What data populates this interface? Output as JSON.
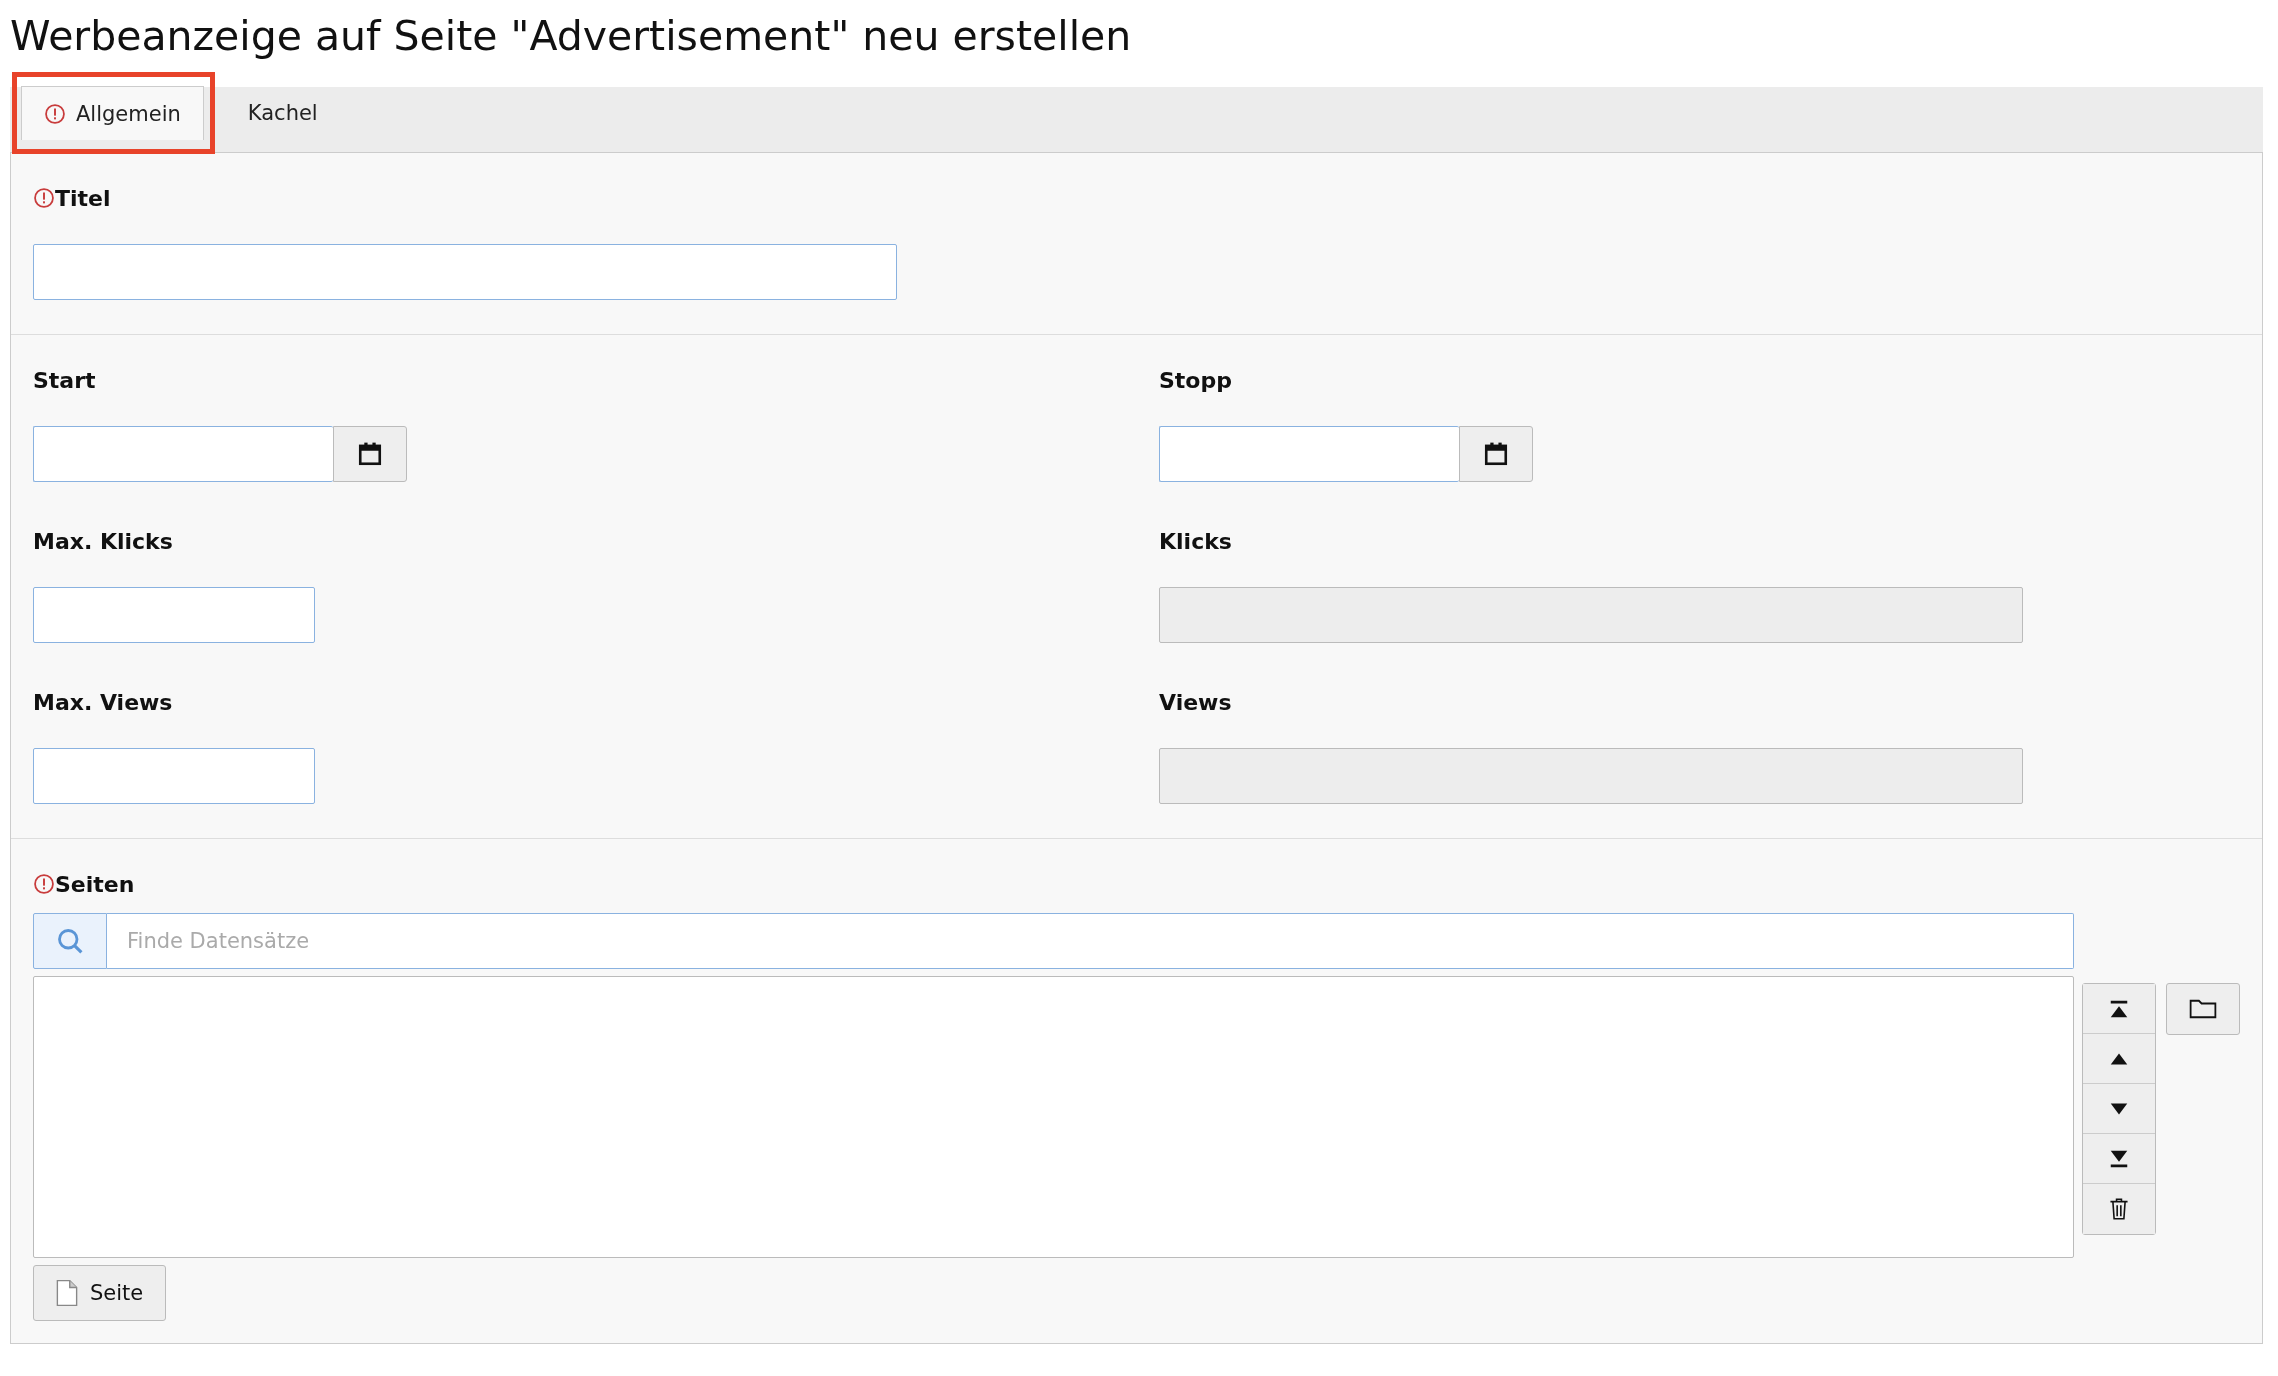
{
  "page_title": "Werbeanzeige auf Seite \"Advertisement\" neu erstellen",
  "tabs": [
    {
      "label": "Allgemein",
      "selected": true,
      "error": true,
      "highlighted": true
    },
    {
      "label": "Kachel",
      "selected": false,
      "error": false,
      "highlighted": false
    }
  ],
  "titel": {
    "label": "Titel",
    "error": true
  },
  "rows": [
    [
      {
        "kind": "date",
        "label": "Start"
      },
      {
        "kind": "date",
        "label": "Stopp"
      }
    ],
    [
      {
        "kind": "number",
        "label": "Max. Klicks"
      },
      {
        "kind": "readonly",
        "label": "Klicks"
      }
    ],
    [
      {
        "kind": "number",
        "label": "Max. Views"
      },
      {
        "kind": "readonly",
        "label": "Views"
      }
    ]
  ],
  "seiten": {
    "label": "Seiten",
    "error": true,
    "search": {
      "placeholder": "Finde Datensätze"
    },
    "add_button": "Seite"
  }
}
